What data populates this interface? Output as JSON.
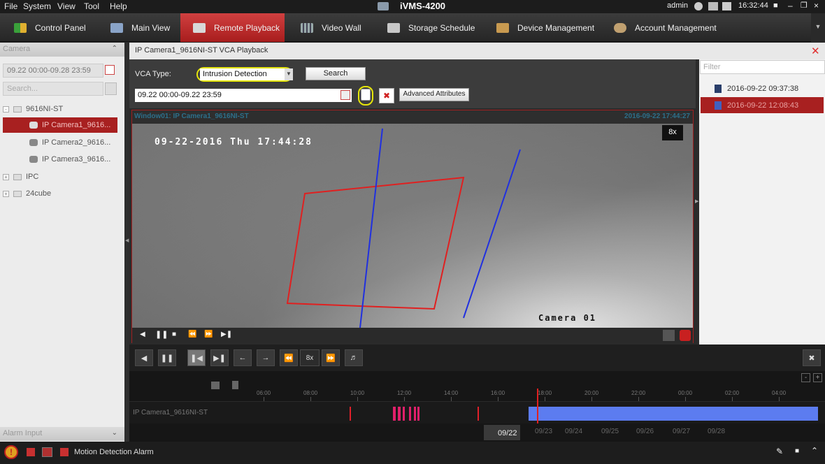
{
  "menu": {
    "items": [
      "File",
      "System",
      "View",
      "Tool",
      "Help"
    ],
    "app_title": "iVMS-4200",
    "user": "admin",
    "time": "16:32:44"
  },
  "tabs": [
    "Control Panel",
    "Main View",
    "Remote Playback",
    "Video Wall",
    "Storage Schedule",
    "Device Management",
    "Account Management"
  ],
  "left": {
    "camera_header": "Camera",
    "date_range": "09.22 00:00-09.28 23:59",
    "search_placeholder": "Search...",
    "tree": {
      "device": "9616NI-ST",
      "cameras": [
        "IP Camera1_9616...",
        "IP Camera2_9616...",
        "IP Camera3_9616..."
      ],
      "groups": [
        "IPC",
        "24cube"
      ]
    },
    "alarm_header": "Alarm Input"
  },
  "playback": {
    "title": "IP Camera1_9616NI-ST VCA Playback",
    "vca_label": "VCA Type:",
    "vca_value": "Intrusion Detection",
    "search_label": "Search",
    "time_range": "09.22 00:00-09.22 23:59",
    "adv_label": "Advanced Attributes",
    "window_label": "Window01: IP Camera1_9616NI-ST",
    "window_time": "2016-09-22 17:44:27",
    "speed_badge": "8x",
    "osd_datetime": "09-22-2016 Thu 17:44:28",
    "osd_camera": "Camera 01"
  },
  "right": {
    "filter_placeholder": "Filter",
    "records": [
      "2016-09-22 09:37:38",
      "2016-09-22 12:08:43"
    ]
  },
  "controls": {
    "speed": "8x"
  },
  "timeline": {
    "ticks": [
      "06:00",
      "08:00",
      "10:00",
      "12:00",
      "14:00",
      "16:00",
      "18:00",
      "20:00",
      "22:00",
      "00:00",
      "02:00",
      "04:00"
    ],
    "channel": "IP Camera1_9616NI-ST",
    "dates": [
      "09/22",
      "09/23",
      "09/24",
      "09/25",
      "09/26",
      "09/27",
      "09/28"
    ]
  },
  "status": {
    "alarm_label": "Motion Detection Alarm"
  },
  "colors": {
    "accent": "#b02020",
    "record_bar": "#5c7cf0",
    "roi": "#e02020",
    "line": "#2030e0"
  }
}
